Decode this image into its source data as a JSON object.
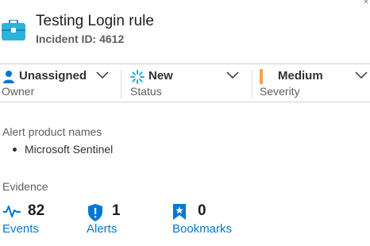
{
  "header": {
    "title": "Testing Login rule",
    "incident_id": "Incident ID: 4612",
    "icon": "briefcase-icon"
  },
  "owner": {
    "value": "Unassigned",
    "label": "Owner",
    "icon": "person-icon"
  },
  "status": {
    "value": "New",
    "label": "Status",
    "icon": "new-status-icon"
  },
  "severity": {
    "value": "Medium",
    "label": "Severity",
    "accent": "#f7a24b"
  },
  "alert_products": {
    "label": "Alert product names",
    "items": [
      "Microsoft Sentinel"
    ]
  },
  "evidence": {
    "label": "Evidence",
    "events": {
      "count": "82",
      "label": "Events",
      "icon": "activity-icon"
    },
    "alerts": {
      "count": "1",
      "label": "Alerts",
      "icon": "shield-alert-icon"
    },
    "bookmarks": {
      "count": "0",
      "label": "Bookmarks",
      "icon": "bookmark-icon"
    }
  },
  "colors": {
    "link": "#0078d4",
    "icon_blue": "#0078d4",
    "briefcase_teal": "#2bb3d9"
  }
}
